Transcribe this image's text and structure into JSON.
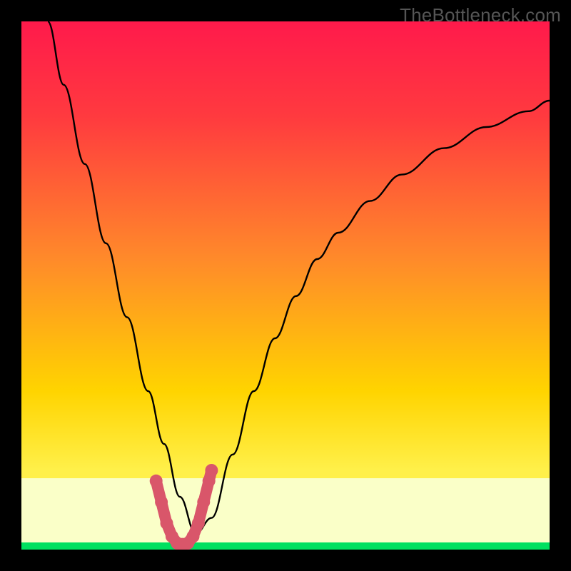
{
  "watermark": "TheBottleneck.com",
  "chart_data": {
    "type": "line",
    "title": "",
    "xlabel": "",
    "ylabel": "",
    "xlim": [
      0,
      100
    ],
    "ylim": [
      0,
      100
    ],
    "background_gradient": {
      "top_color": "#ff1a4b",
      "mid_color": "#ffd400",
      "bottom_band_color": "#faffc8",
      "baseline_color": "#00e060"
    },
    "series": [
      {
        "name": "curve",
        "style": "black-thin",
        "x": [
          5,
          8,
          12,
          16,
          20,
          24,
          27,
          30,
          33,
          36,
          40,
          44,
          48,
          52,
          56,
          60,
          66,
          72,
          80,
          88,
          96,
          100
        ],
        "y": [
          100,
          88,
          73,
          58,
          44,
          30,
          20,
          10,
          3,
          6,
          18,
          30,
          40,
          48,
          55,
          60,
          66,
          71,
          76,
          80,
          83,
          85
        ]
      },
      {
        "name": "highlight-dots",
        "style": "red-thick-dots",
        "x": [
          25.5,
          26.5,
          27.5,
          28.5,
          29.5,
          30.5,
          31.5,
          32.5,
          33.5,
          34.5,
          35.5,
          36.0
        ],
        "y": [
          13,
          9,
          5,
          2.5,
          1.2,
          1.0,
          1.2,
          2.5,
          5,
          9,
          13,
          15
        ]
      }
    ]
  }
}
